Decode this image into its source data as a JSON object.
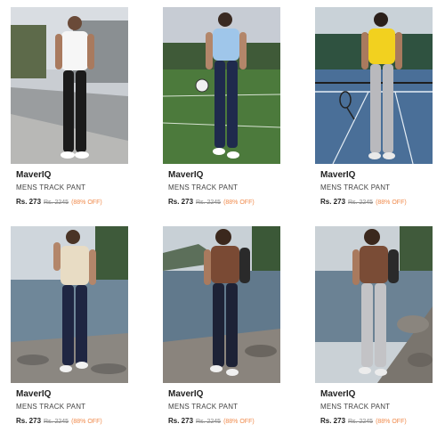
{
  "products": [
    {
      "brand": "MaverIQ",
      "title": "MENS TRACK PANT",
      "price": "Rs. 273",
      "mrp": "Rs. 2245",
      "discount": "(88% OFF)",
      "photo": {
        "scene": "street",
        "shirt": "#f6f6f6",
        "pants": "#1b1b1b"
      }
    },
    {
      "brand": "MaverIQ",
      "title": "MENS TRACK PANT",
      "price": "Rs. 273",
      "mrp": "Rs. 2245",
      "discount": "(88% OFF)",
      "photo": {
        "scene": "field",
        "shirt": "#9fc6ea",
        "pants": "#1f2a4d"
      }
    },
    {
      "brand": "MaverIQ",
      "title": "MENS TRACK PANT",
      "price": "Rs. 273",
      "mrp": "Rs. 2245",
      "discount": "(88% OFF)",
      "photo": {
        "scene": "tennis",
        "shirt": "#f2d11f",
        "pants": "#b9b9bd"
      }
    },
    {
      "brand": "MaverIQ",
      "title": "MENS TRACK PANT",
      "price": "Rs. 273",
      "mrp": "Rs. 2245",
      "discount": "(88% OFF)",
      "photo": {
        "scene": "lake",
        "shirt": "#e8dcc4",
        "pants": "#1f2642"
      }
    },
    {
      "brand": "MaverIQ",
      "title": "MENS TRACK PANT",
      "price": "Rs. 273",
      "mrp": "Rs. 2245",
      "discount": "(88% OFF)",
      "photo": {
        "scene": "shore",
        "shirt": "#7a4a34",
        "pants": "#1d2236"
      }
    },
    {
      "brand": "MaverIQ",
      "title": "MENS TRACK PANT",
      "price": "Rs. 273",
      "mrp": "Rs. 2245",
      "discount": "(88% OFF)",
      "photo": {
        "scene": "rocks",
        "shirt": "#7a4c36",
        "pants": "#c3c3c6"
      }
    }
  ],
  "colors": {
    "discount": "#f08a4b",
    "text": "#222222"
  }
}
